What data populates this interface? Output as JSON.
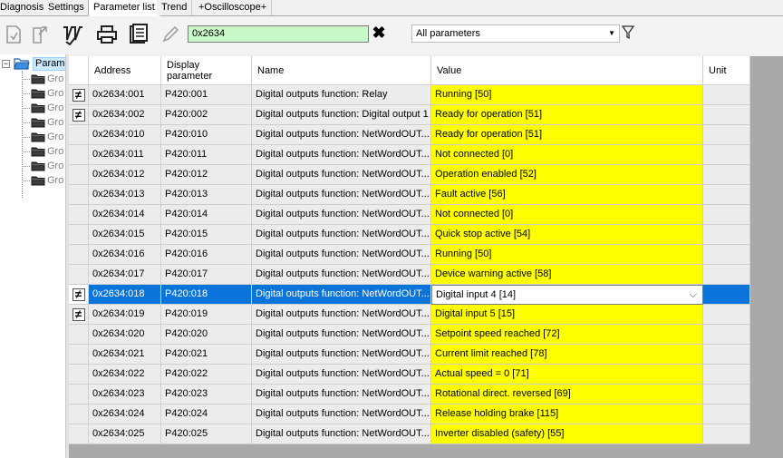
{
  "tabs": [
    {
      "label": "Diagnosis",
      "active": false
    },
    {
      "label": "Settings",
      "active": false
    },
    {
      "label": "Parameter list",
      "active": true
    },
    {
      "label": "Trend",
      "active": false
    },
    {
      "label": "+Oscilloscope+",
      "active": false
    }
  ],
  "toolbar": {
    "search_value": "0x2634",
    "filter_value": "All parameters",
    "icons": [
      "import-icon",
      "export-icon",
      "write-icon",
      "print-icon",
      "document-icon",
      "edit-pencil-icon",
      "clear-icon",
      "funnel-icon"
    ]
  },
  "tree": {
    "root_label": "Parame",
    "items": [
      "Gro",
      "Gro",
      "Gro",
      "Gro",
      "Gro",
      "Gro",
      "Gro",
      "Gro"
    ]
  },
  "grid": {
    "headers": {
      "address": "Address",
      "display_parameter": "Display parameter",
      "name": "Name",
      "value": "Value",
      "unit": "Unit"
    },
    "rows": [
      {
        "modified": true,
        "address": "0x2634:001",
        "display": "P420:001",
        "name": "Digital outputs function: Relay",
        "value": "Running [50]",
        "unit": ""
      },
      {
        "modified": true,
        "address": "0x2634:002",
        "display": "P420:002",
        "name": "Digital outputs function: Digital output 1",
        "value": "Ready for operation [51]",
        "unit": ""
      },
      {
        "modified": false,
        "address": "0x2634:010",
        "display": "P420:010",
        "name": "Digital outputs function: NetWordOUT...",
        "value": "Ready for operation [51]",
        "unit": ""
      },
      {
        "modified": false,
        "address": "0x2634:011",
        "display": "P420:011",
        "name": "Digital outputs function: NetWordOUT...",
        "value": "Not connected [0]",
        "unit": ""
      },
      {
        "modified": false,
        "address": "0x2634:012",
        "display": "P420:012",
        "name": "Digital outputs function: NetWordOUT...",
        "value": "Operation enabled [52]",
        "unit": ""
      },
      {
        "modified": false,
        "address": "0x2634:013",
        "display": "P420:013",
        "name": "Digital outputs function: NetWordOUT...",
        "value": "Fault active [56]",
        "unit": ""
      },
      {
        "modified": false,
        "address": "0x2634:014",
        "display": "P420:014",
        "name": "Digital outputs function: NetWordOUT...",
        "value": "Not connected [0]",
        "unit": ""
      },
      {
        "modified": false,
        "address": "0x2634:015",
        "display": "P420:015",
        "name": "Digital outputs function: NetWordOUT...",
        "value": "Quick stop active [54]",
        "unit": ""
      },
      {
        "modified": false,
        "address": "0x2634:016",
        "display": "P420:016",
        "name": "Digital outputs function: NetWordOUT...",
        "value": "Running [50]",
        "unit": ""
      },
      {
        "modified": false,
        "address": "0x2634:017",
        "display": "P420:017",
        "name": "Digital outputs function: NetWordOUT...",
        "value": "Device warning active [58]",
        "unit": ""
      },
      {
        "modified": true,
        "selected": true,
        "address": "0x2634:018",
        "display": "P420:018",
        "name": "Digital outputs function: NetWordOUT...",
        "value": "Digital input 4 [14]",
        "unit": ""
      },
      {
        "modified": true,
        "address": "0x2634:019",
        "display": "P420:019",
        "name": "Digital outputs function: NetWordOUT...",
        "value": "Digital input 5 [15]",
        "unit": ""
      },
      {
        "modified": false,
        "address": "0x2634:020",
        "display": "P420:020",
        "name": "Digital outputs function: NetWordOUT...",
        "value": "Setpoint speed reached [72]",
        "unit": ""
      },
      {
        "modified": false,
        "address": "0x2634:021",
        "display": "P420:021",
        "name": "Digital outputs function: NetWordOUT...",
        "value": "Current limit reached [78]",
        "unit": ""
      },
      {
        "modified": false,
        "address": "0x2634:022",
        "display": "P420:022",
        "name": "Digital outputs function: NetWordOUT...",
        "value": "Actual speed = 0 [71]",
        "unit": ""
      },
      {
        "modified": false,
        "address": "0x2634:023",
        "display": "P420:023",
        "name": "Digital outputs function: NetWordOUT...",
        "value": "Rotational direct. reversed [69]",
        "unit": ""
      },
      {
        "modified": false,
        "address": "0x2634:024",
        "display": "P420:024",
        "name": "Digital outputs function: NetWordOUT...",
        "value": "Release holding brake [115]",
        "unit": ""
      },
      {
        "modified": false,
        "address": "0x2634:025",
        "display": "P420:025",
        "name": "Digital outputs function: NetWordOUT...",
        "value": "Inverter disabled (safety) [55]",
        "unit": ""
      }
    ]
  },
  "colors": {
    "value_highlight": "#ffff00",
    "selection": "#0a74da",
    "search_bg": "#c8f7c8"
  }
}
